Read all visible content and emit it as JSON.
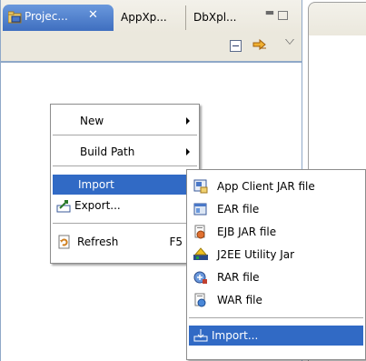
{
  "tabs": {
    "active": {
      "label": "Projec...",
      "icon": "project-explorer-icon"
    },
    "items": [
      {
        "label": "AppXp..."
      },
      {
        "label": "DbXpl..."
      }
    ]
  },
  "window_controls": {
    "minimize": "minimize-icon",
    "maximize": "maximize-icon"
  },
  "toolbar": {
    "icons": [
      "collapse-all-icon",
      "link-with-editor-icon",
      "view-menu-icon"
    ]
  },
  "context_menu": {
    "items": [
      {
        "label": "New",
        "has_submenu": true
      },
      {
        "label": "Build Path",
        "has_submenu": true
      },
      {
        "label": "Import",
        "has_submenu": true,
        "selected": true
      },
      {
        "label": "Export...",
        "icon": "export-icon"
      },
      {
        "label": "Refresh",
        "icon": "refresh-icon",
        "accelerator": "F5"
      }
    ]
  },
  "import_submenu": {
    "items": [
      {
        "label": "App Client JAR file",
        "icon": "app-client-jar-icon"
      },
      {
        "label": "EAR file",
        "icon": "ear-file-icon"
      },
      {
        "label": "EJB JAR file",
        "icon": "ejb-jar-icon"
      },
      {
        "label": "J2EE Utility Jar",
        "icon": "j2ee-utility-jar-icon"
      },
      {
        "label": "RAR file",
        "icon": "rar-file-icon"
      },
      {
        "label": "WAR file",
        "icon": "war-file-icon"
      },
      {
        "label": "Import...",
        "icon": "import-wizard-icon",
        "selected": true
      }
    ]
  },
  "colors": {
    "selection": "#316ac5",
    "active_tab": "#4a7fd0",
    "frame": "#8fa8c8"
  }
}
